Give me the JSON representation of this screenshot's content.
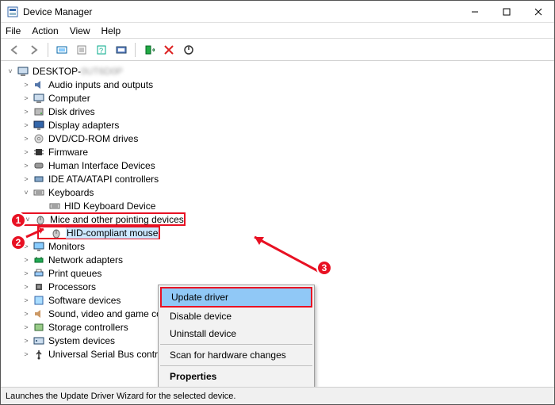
{
  "window": {
    "title": "Device Manager"
  },
  "menubar": [
    "File",
    "Action",
    "View",
    "Help"
  ],
  "root": {
    "label": "DESKTOP-"
  },
  "tree": [
    {
      "label": "Audio inputs and outputs",
      "icon": "audio"
    },
    {
      "label": "Computer",
      "icon": "pc"
    },
    {
      "label": "Disk drives",
      "icon": "disk"
    },
    {
      "label": "Display adapters",
      "icon": "display"
    },
    {
      "label": "DVD/CD-ROM drives",
      "icon": "dvd"
    },
    {
      "label": "Firmware",
      "icon": "chip"
    },
    {
      "label": "Human Interface Devices",
      "icon": "hid"
    },
    {
      "label": "IDE ATA/ATAPI controllers",
      "icon": "ide"
    },
    {
      "label": "Keyboards",
      "icon": "keyboard",
      "expanded": true
    },
    {
      "label": "HID Keyboard Device",
      "icon": "keyboard",
      "depth": 2
    },
    {
      "label": "Mice and other pointing devices",
      "icon": "mouse",
      "highlight": 1,
      "expanded": true
    },
    {
      "label": "HID-compliant mouse",
      "icon": "mouse",
      "depth": 2,
      "highlight": 2,
      "selected": true
    },
    {
      "label": "Monitors",
      "icon": "monitor"
    },
    {
      "label": "Network adapters",
      "icon": "net"
    },
    {
      "label": "Print queues",
      "icon": "printer"
    },
    {
      "label": "Processors",
      "icon": "cpu"
    },
    {
      "label": "Software devices",
      "icon": "soft"
    },
    {
      "label": "Sound, video and game co",
      "icon": "sound"
    },
    {
      "label": "Storage controllers",
      "icon": "storage"
    },
    {
      "label": "System devices",
      "icon": "sys"
    },
    {
      "label": "Universal Serial Bus controllers",
      "icon": "usb"
    }
  ],
  "context_menu": {
    "items": [
      {
        "label": "Update driver",
        "selected": true,
        "badge": 3
      },
      {
        "label": "Disable device"
      },
      {
        "label": "Uninstall device"
      },
      {
        "sep": true
      },
      {
        "label": "Scan for hardware changes"
      },
      {
        "sep": true
      },
      {
        "label": "Properties",
        "bold": true
      }
    ]
  },
  "statusbar": "Launches the Update Driver Wizard for the selected device.",
  "annotations": {
    "badge1": "1",
    "badge2": "2",
    "badge3": "3"
  }
}
